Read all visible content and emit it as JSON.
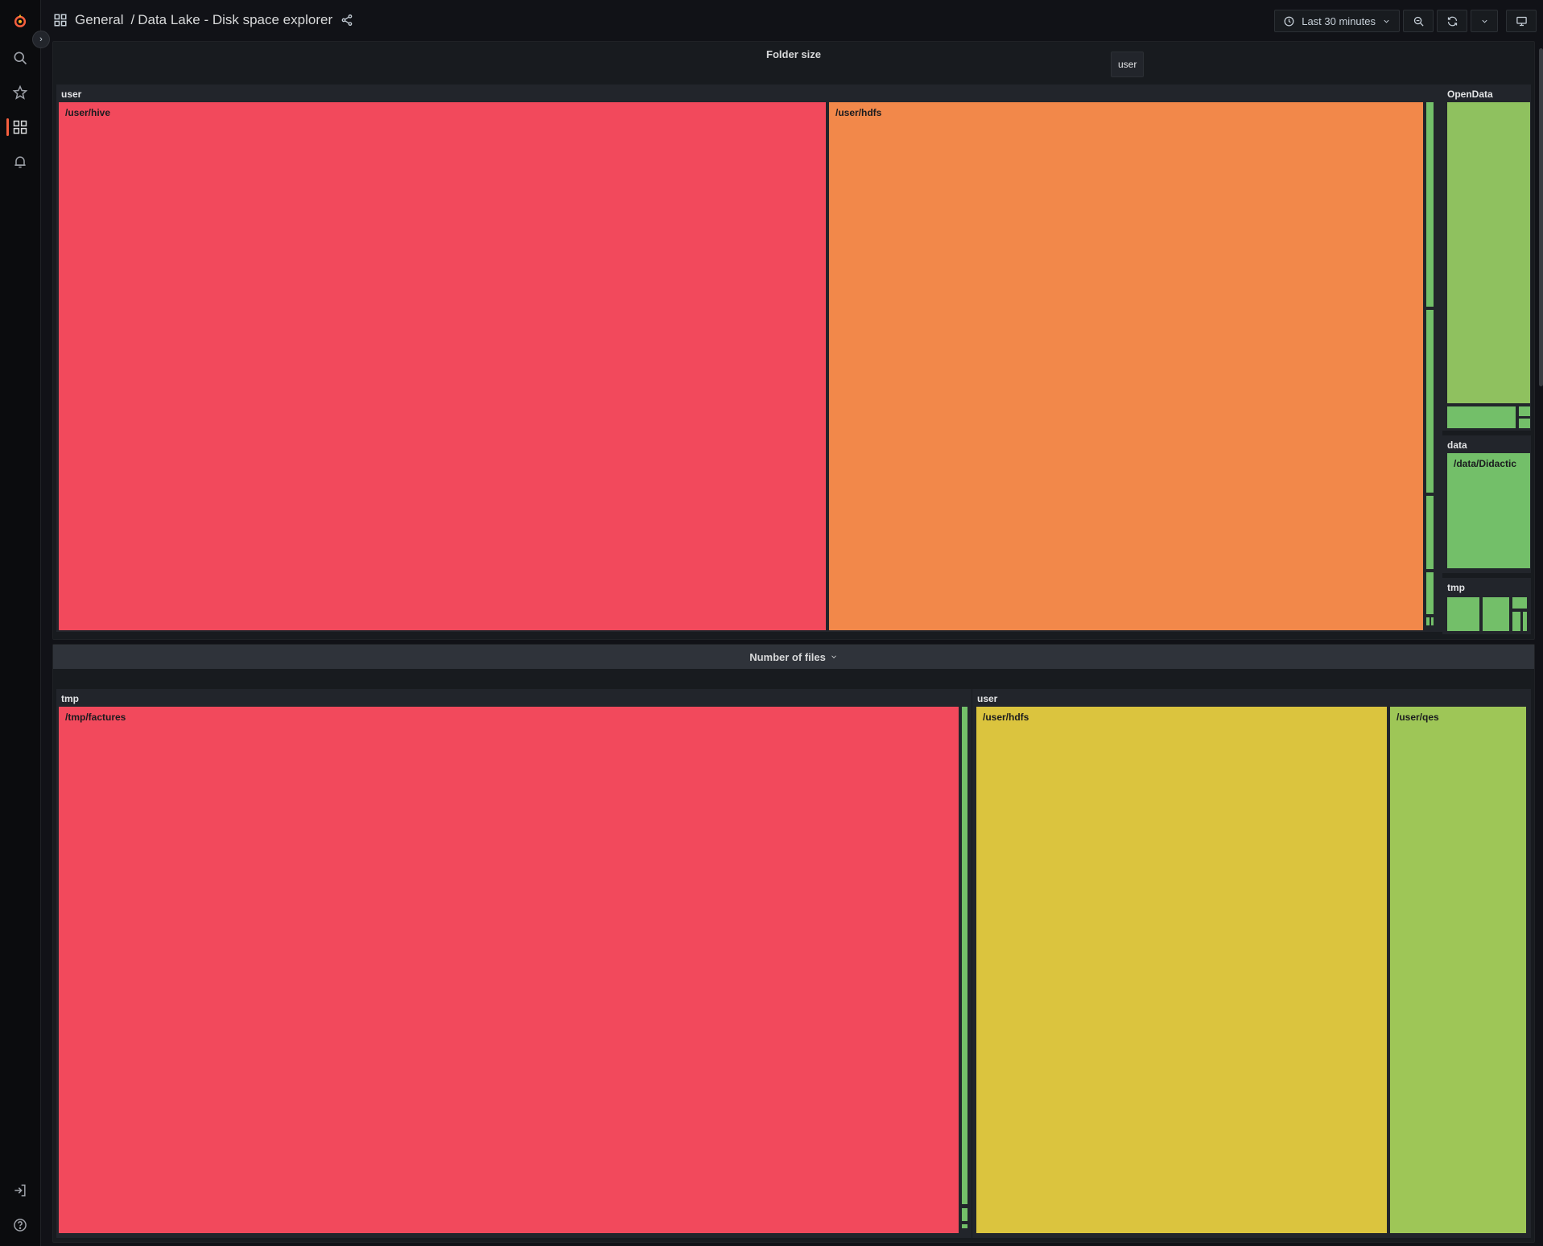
{
  "header": {
    "section": "General",
    "separator": "/",
    "dashboard_title": "Data Lake - Disk space explorer",
    "time_range": "Last 30 minutes"
  },
  "sidebar": {
    "items": [
      {
        "name": "grafana-logo-icon"
      },
      {
        "name": "search-icon"
      },
      {
        "name": "star-icon"
      },
      {
        "name": "dashboards-icon"
      },
      {
        "name": "bell-icon"
      },
      {
        "name": "sign-in-icon"
      },
      {
        "name": "help-icon"
      }
    ]
  },
  "colors": {
    "red": "#f2495c",
    "orange": "#f2884a",
    "yellow": "#dbc43e",
    "light_green": "#9ec657",
    "green": "#73bf69",
    "accent": "#f55f3e"
  },
  "panels": {
    "folder_size": {
      "title": "Folder size",
      "tooltip": "user",
      "groups": {
        "user": "user",
        "opendata": "OpenData",
        "data": "data",
        "tmp": "tmp"
      },
      "cells": {
        "user_hive": "/user/hive",
        "user_hdfs": "/user/hdfs",
        "data_didactic": "/data/Didactic"
      }
    },
    "number_of_files": {
      "title": "Number of files",
      "groups": {
        "tmp": "tmp",
        "user": "user"
      },
      "cells": {
        "tmp_factures": "/tmp/factures",
        "user_hdfs": "/user/hdfs",
        "user_qes": "/user/qes"
      }
    }
  }
}
